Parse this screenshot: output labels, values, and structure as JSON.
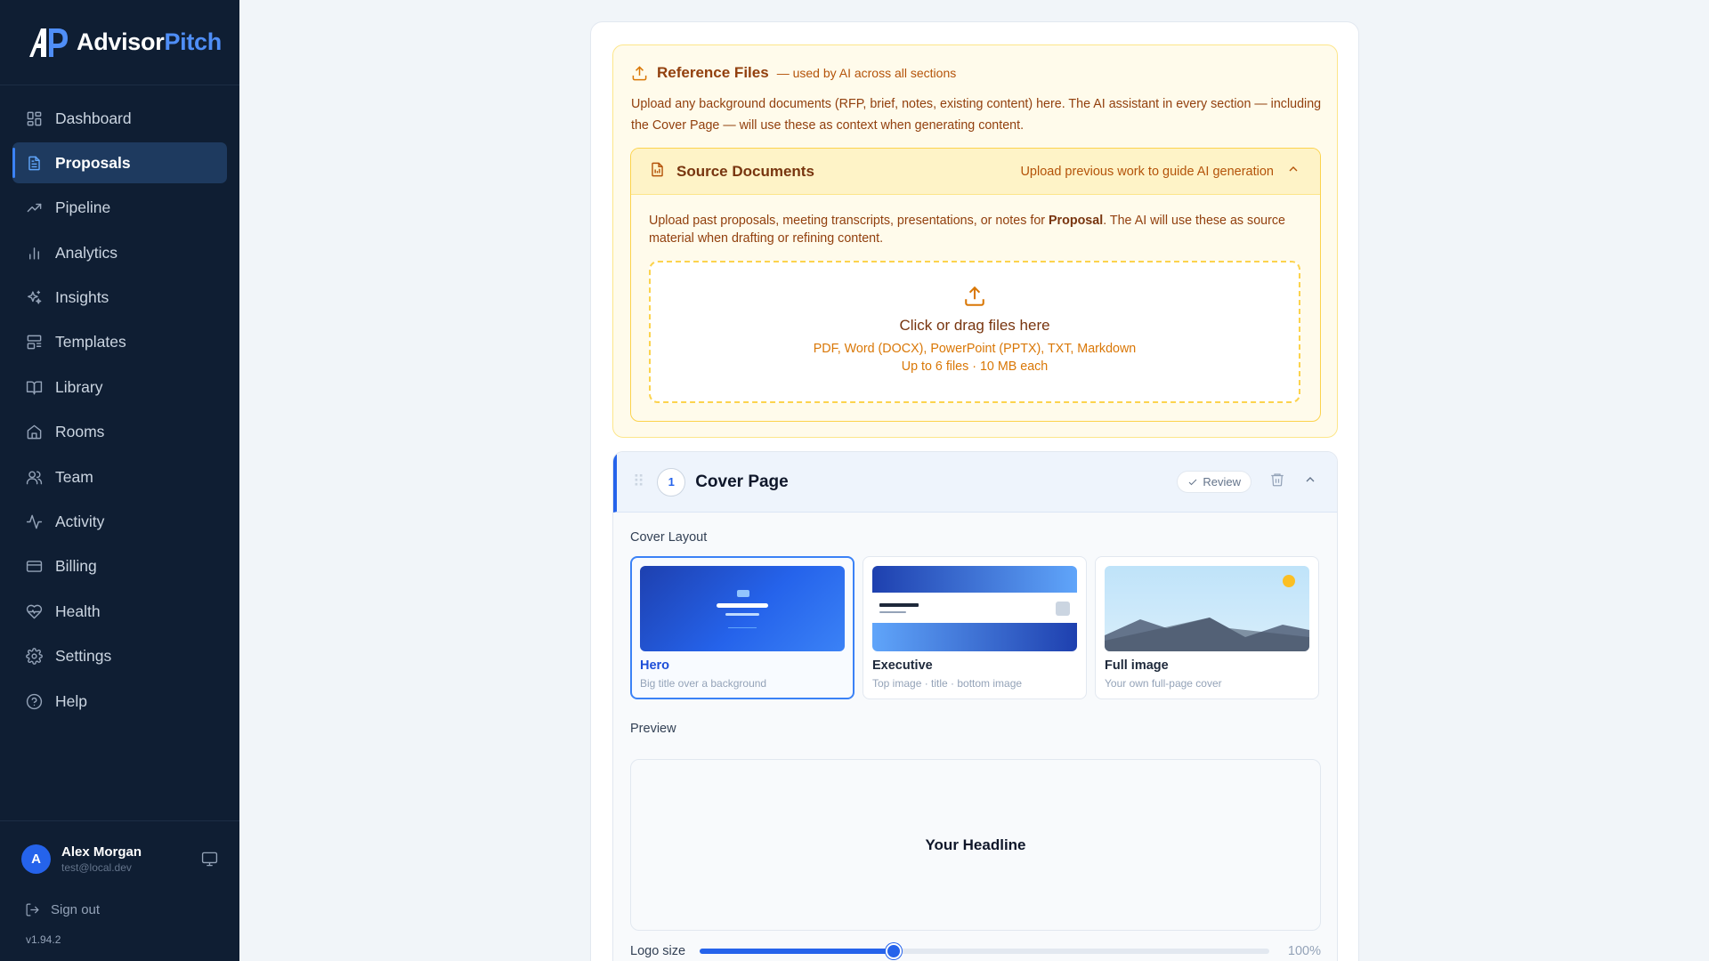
{
  "brand": {
    "name_a": "Advisor",
    "name_b": "Pitch",
    "accent": "#4f8ef7"
  },
  "sidebar": {
    "items": [
      {
        "label": "Dashboard",
        "icon": "dashboard-icon",
        "active": false
      },
      {
        "label": "Proposals",
        "icon": "document-icon",
        "active": true
      },
      {
        "label": "Pipeline",
        "icon": "trending-icon",
        "active": false
      },
      {
        "label": "Analytics",
        "icon": "bar-chart-icon",
        "active": false
      },
      {
        "label": "Insights",
        "icon": "sparkles-icon",
        "active": false
      },
      {
        "label": "Templates",
        "icon": "templates-icon",
        "active": false
      },
      {
        "label": "Library",
        "icon": "book-icon",
        "active": false
      },
      {
        "label": "Rooms",
        "icon": "home-icon",
        "active": false
      },
      {
        "label": "Team",
        "icon": "users-icon",
        "active": false
      },
      {
        "label": "Activity",
        "icon": "activity-icon",
        "active": false
      },
      {
        "label": "Billing",
        "icon": "credit-card-icon",
        "active": false
      },
      {
        "label": "Health",
        "icon": "heart-pulse-icon",
        "active": false
      },
      {
        "label": "Settings",
        "icon": "gear-icon",
        "active": false
      },
      {
        "label": "Help",
        "icon": "help-circle-icon",
        "active": false
      }
    ]
  },
  "user": {
    "initial": "A",
    "name": "Alex Morgan",
    "email": "test@local.dev",
    "sign_out": "Sign out",
    "version": "v1.94.2"
  },
  "reference": {
    "title": "Reference Files",
    "subtitle": "— used by AI across all sections",
    "description": "Upload any background documents (RFP, brief, notes, existing content) here. The AI assistant in every section — including the Cover Page — will use these as context when generating content.",
    "source": {
      "title": "Source Documents",
      "hint": "Upload previous work to guide AI generation",
      "desc_pre": "Upload past proposals, meeting transcripts, presentations, or notes for ",
      "desc_bold": "Proposal",
      "desc_post": ". The AI will use these as source material when drafting or refining content.",
      "drop_title": "Click or drag files here",
      "drop_formats": "PDF, Word (DOCX), PowerPoint (PPTX), TXT, Markdown",
      "drop_limits": "Up to 6 files · 10 MB each"
    }
  },
  "section": {
    "number": "1",
    "title": "Cover Page",
    "review_label": "Review",
    "cover_layout_label": "Cover Layout",
    "layouts": [
      {
        "name": "Hero",
        "desc": "Big title over a background",
        "selected": true
      },
      {
        "name": "Executive",
        "desc": "Top image · title · bottom image",
        "selected": false
      },
      {
        "name": "Full image",
        "desc": "Your own full-page cover",
        "selected": false
      }
    ],
    "preview_label": "Preview",
    "preview_headline": "Your Headline",
    "logo_size_label": "Logo size",
    "logo_size_value": "100%",
    "logo_slider_fraction": 0.34
  },
  "colors": {
    "sidebar_bg": "#0f1e33",
    "primary": "#2563eb",
    "amber_bg": "#fffbeb",
    "amber_text": "#92400e"
  }
}
